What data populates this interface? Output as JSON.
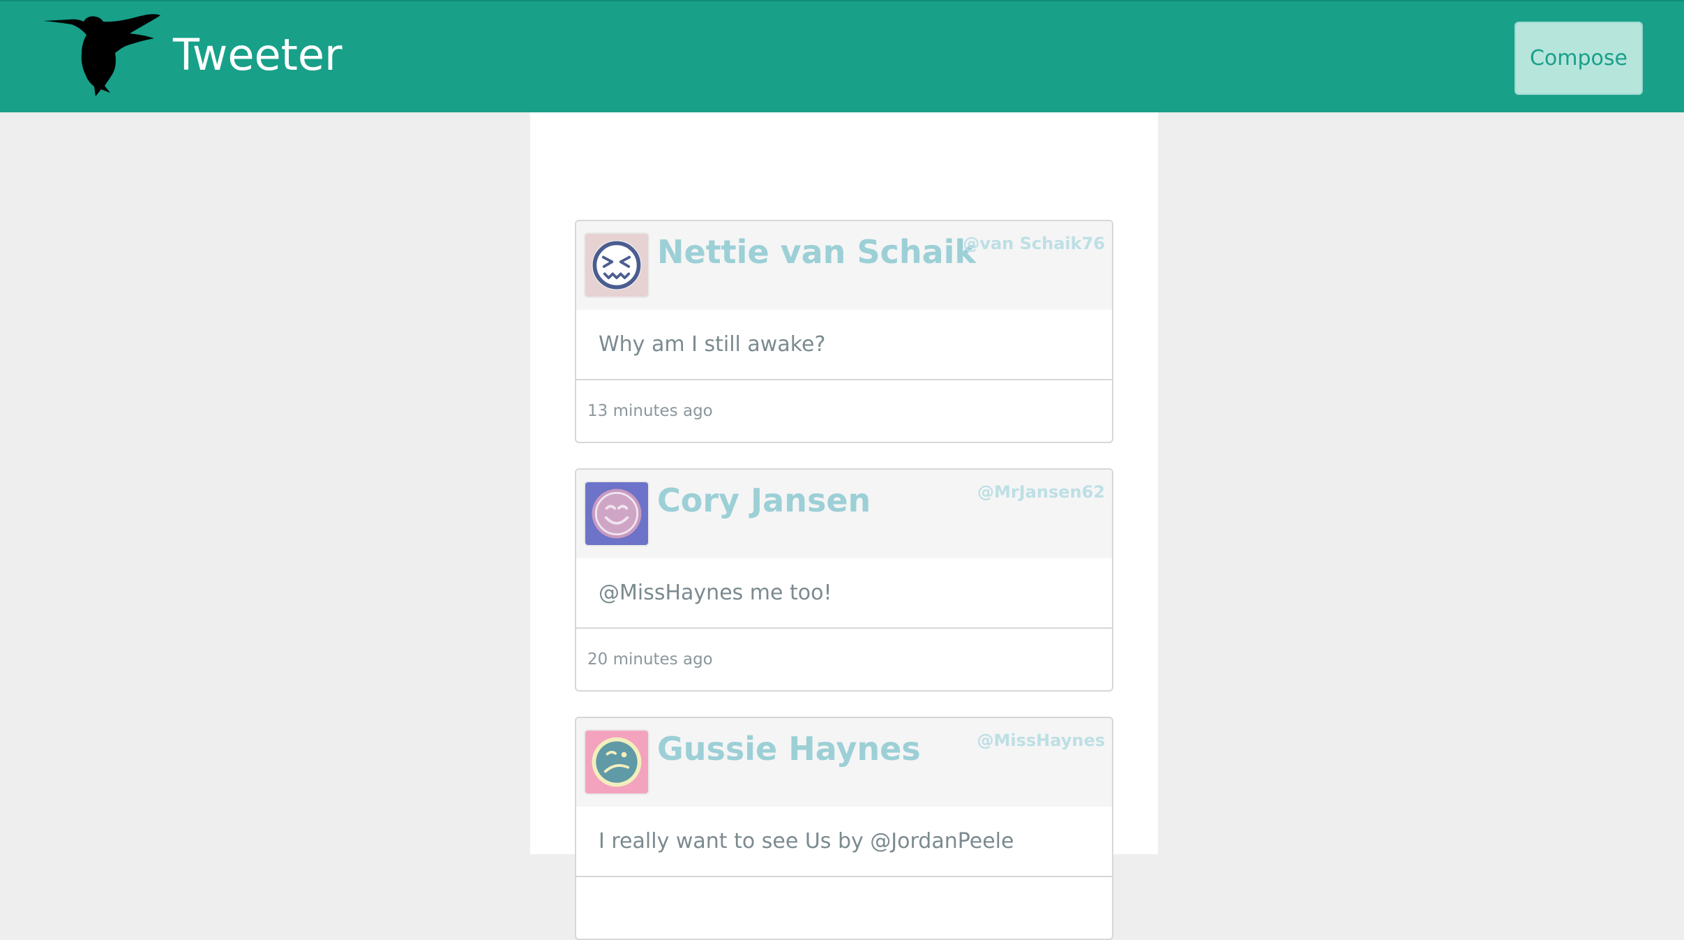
{
  "header": {
    "title": "Tweeter",
    "compose_label": "Compose",
    "logo_icon": "hummingbird-icon",
    "background_color": "#18a089"
  },
  "tweets": [
    {
      "name": "Nettie van Schaik",
      "handle": "@van Schaik76",
      "text": "Why am I still awake?",
      "time": "13 minutes ago",
      "avatar_icon": "grimace-face-icon",
      "avatar_bg": "#e6d2d2",
      "avatar_fg": "#4b5d8f",
      "avatar_ring": "#ffffff"
    },
    {
      "name": "Cory Jansen",
      "handle": "@MrJansen62",
      "text": "@MissHaynes me too!",
      "time": "20 minutes ago",
      "avatar_icon": "smile-face-icon",
      "avatar_bg": "#6c73c8",
      "avatar_fg": "#cfa5c6",
      "avatar_ring": "#c89ac0"
    },
    {
      "name": "Gussie Haynes",
      "handle": "@MissHaynes",
      "text": "I really want to see Us by @JordanPeele",
      "time": "",
      "avatar_icon": "confused-face-icon",
      "avatar_bg": "#f3a3be",
      "avatar_fg": "#f2efbd",
      "avatar_ring": "#5f9aa6"
    }
  ]
}
